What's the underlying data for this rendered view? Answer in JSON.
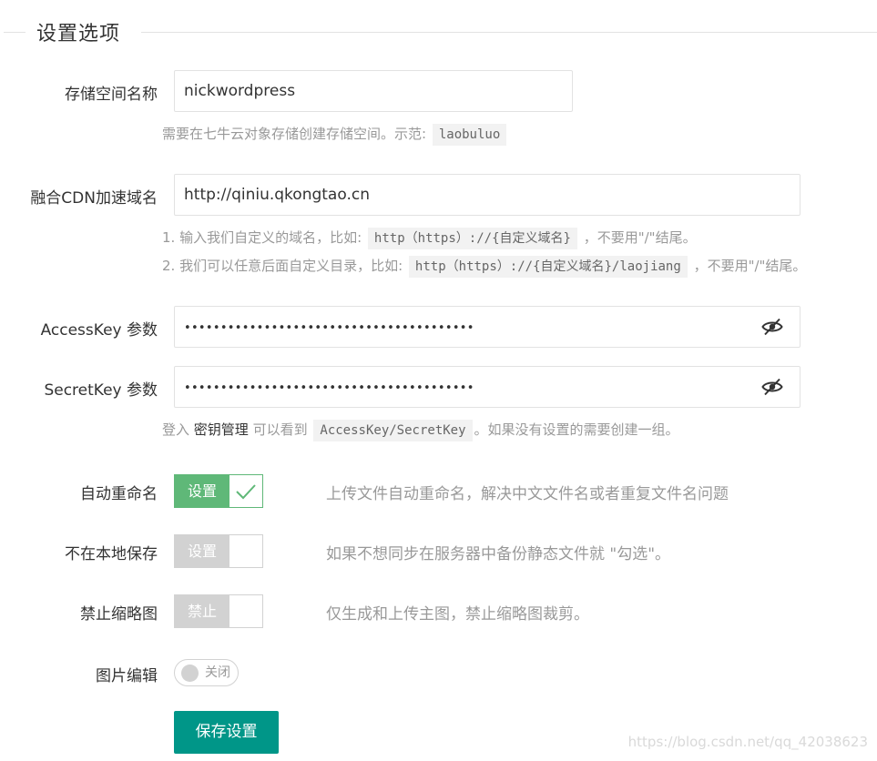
{
  "fieldset": {
    "title": "设置选项"
  },
  "bucket": {
    "label": "存储空间名称",
    "value": "nickwordpress",
    "help_prefix": "需要在七牛云对象存储创建存储空间。示范:",
    "help_code": "laobuluo"
  },
  "cdn": {
    "label": "融合CDN加速域名",
    "value": "http://qiniu.qkongtao.cn",
    "help1_prefix": "1. 输入我们自定义的域名，比如:",
    "help1_code": "http（https）://{自定义域名}",
    "help1_suffix": "，不要用\"/\"结尾。",
    "help2_prefix": "2. 我们可以任意后面自定义目录，比如:",
    "help2_code": "http（https）://{自定义域名}/laojiang",
    "help2_suffix": "，不要用\"/\"结尾。"
  },
  "access_key": {
    "label": "AccessKey 参数",
    "value": "••••••••••••••••••••••••••••••••••••••••",
    "icon": "eye-slash-icon"
  },
  "secret_key": {
    "label": "SecretKey 参数",
    "value": "••••••••••••••••••••••••••••••••••••••••",
    "icon": "eye-slash-icon",
    "help_prefix": "登入",
    "help_link": "密钥管理",
    "help_middle": "可以看到",
    "help_code": "AccessKey/SecretKey",
    "help_suffix": "。如果没有设置的需要创建一组。"
  },
  "auto_rename": {
    "label": "自动重命名",
    "switch_text": "设置",
    "checked": true,
    "description": "上传文件自动重命名，解决中文文件名或者重复文件名问题"
  },
  "no_local": {
    "label": "不在本地保存",
    "switch_text": "设置",
    "checked": false,
    "description": "如果不想同步在服务器中备份静态文件就 \"勾选\"。"
  },
  "no_thumb": {
    "label": "禁止缩略图",
    "switch_text": "禁止",
    "checked": false,
    "description": "仅生成和上传主图，禁止缩略图裁剪。"
  },
  "image_edit": {
    "label": "图片编辑",
    "toggle_text": "关闭",
    "on": false
  },
  "save_button": {
    "label": "保存设置"
  },
  "watermark": "https://blog.csdn.net/qq_42038623",
  "colors": {
    "switch_on": "#5fb878",
    "switch_off": "#d2d2d2",
    "primary_button": "#009688"
  }
}
